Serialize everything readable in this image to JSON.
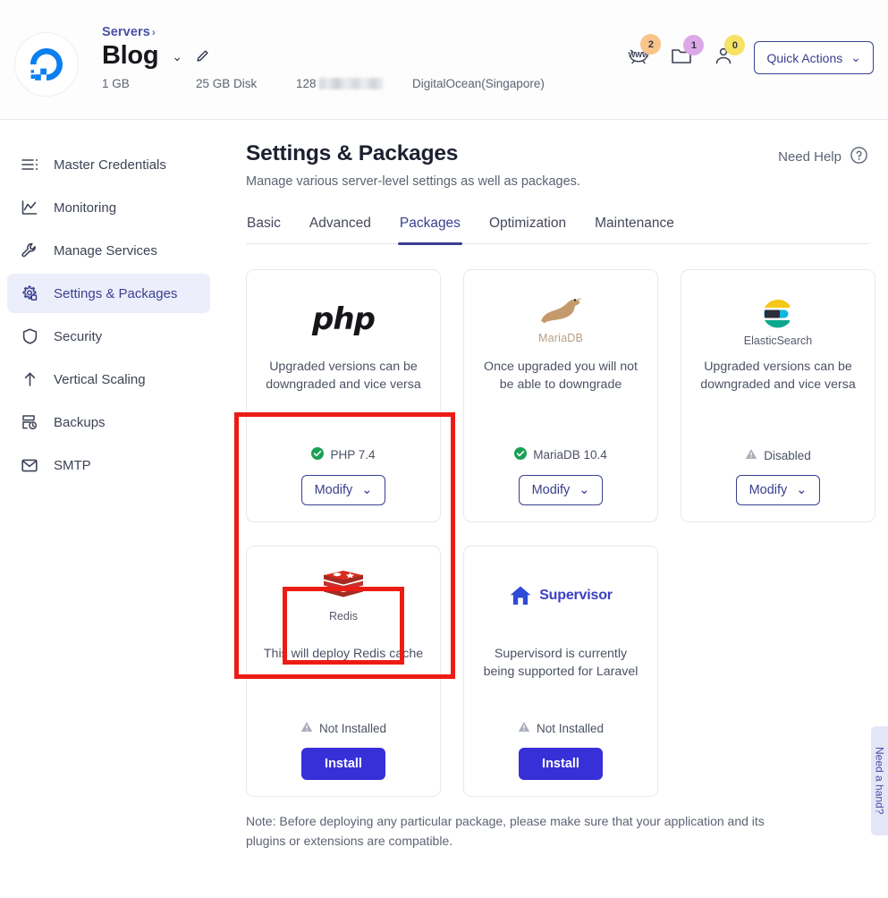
{
  "header": {
    "logo_icon": "digitalocean-logo",
    "breadcrumb": "Servers",
    "breadcrumb_chevron": "›",
    "server_name": "Blog",
    "caret": "⌄",
    "edit_icon": "pencil-icon",
    "specs": {
      "ram": "1 GB",
      "disk": "25 GB Disk",
      "ip_prefix": "128",
      "provider": "DigitalOcean(Singapore)"
    },
    "icons": [
      {
        "name": "www-icon",
        "badge": "2",
        "badge_color": "#f8c48a"
      },
      {
        "name": "folder-icon",
        "badge": "1",
        "badge_color": "#dba9e8"
      },
      {
        "name": "user-icon",
        "badge": "0",
        "badge_color": "#f6e263"
      }
    ],
    "quick_actions_label": "Quick Actions",
    "quick_actions_caret": "⌄"
  },
  "sidebar": {
    "items": [
      {
        "label": "Master Credentials",
        "icon": "list-icon",
        "active": false
      },
      {
        "label": "Monitoring",
        "icon": "chart-line-icon",
        "active": false
      },
      {
        "label": "Manage Services",
        "icon": "wrench-icon",
        "active": false
      },
      {
        "label": "Settings & Packages",
        "icon": "gear-icon",
        "active": true
      },
      {
        "label": "Security",
        "icon": "shield-icon",
        "active": false
      },
      {
        "label": "Vertical Scaling",
        "icon": "arrow-up-icon",
        "active": false
      },
      {
        "label": "Backups",
        "icon": "backup-icon",
        "active": false
      },
      {
        "label": "SMTP",
        "icon": "mail-icon",
        "active": false
      }
    ]
  },
  "main": {
    "title": "Settings & Packages",
    "subtitle": "Manage various server-level settings as well as packages.",
    "need_help_label": "Need Help",
    "need_help_icon": "question-circle-icon",
    "tabs": [
      {
        "label": "Basic",
        "active": false
      },
      {
        "label": "Advanced",
        "active": false
      },
      {
        "label": "Packages",
        "active": true
      },
      {
        "label": "Optimization",
        "active": false
      },
      {
        "label": "Maintenance",
        "active": false
      }
    ],
    "cards": [
      {
        "id": "php",
        "logo": "php-logo",
        "logo_text": "php",
        "caption": "",
        "description": "Upgraded versions can be downgraded and vice versa",
        "status_icon": "check-circle-icon",
        "status_text": "PHP 7.4",
        "status_color": "#1aa055",
        "action_label": "Modify",
        "action_caret": "⌄",
        "action_type": "modify"
      },
      {
        "id": "mariadb",
        "logo": "mariadb-logo",
        "logo_text": "",
        "caption": "MariaDB",
        "description": "Once upgraded you will not be able to downgrade",
        "status_icon": "check-circle-icon",
        "status_text": "MariaDB 10.4",
        "status_color": "#1aa055",
        "action_label": "Modify",
        "action_caret": "⌄",
        "action_type": "modify"
      },
      {
        "id": "elasticsearch",
        "logo": "elasticsearch-logo",
        "logo_text": "",
        "caption": "ElasticSearch",
        "description": "Upgraded versions can be downgraded and vice versa",
        "status_icon": "warning-triangle-icon",
        "status_text": "Disabled",
        "status_color": "#9aa0ad",
        "action_label": "Modify",
        "action_caret": "⌄",
        "action_type": "modify"
      },
      {
        "id": "redis",
        "logo": "redis-logo",
        "logo_text": "",
        "caption": "Redis",
        "description": "This will deploy Redis cache",
        "status_icon": "warning-triangle-icon",
        "status_text": "Not Installed",
        "status_color": "#9aa0ad",
        "action_label": "Install",
        "action_caret": "",
        "action_type": "install"
      },
      {
        "id": "supervisor",
        "logo": "supervisor-logo",
        "logo_text": "Supervisor",
        "caption": "",
        "description": "Supervisord is currently being supported for Laravel",
        "status_icon": "warning-triangle-icon",
        "status_text": "Not Installed",
        "status_color": "#9aa0ad",
        "action_label": "Install",
        "action_caret": "",
        "action_type": "install"
      }
    ],
    "note": "Note: Before deploying any particular package, please make sure that your application and its plugins or extensions are compatible."
  },
  "side_tab": {
    "label": "Need a hand?"
  },
  "annotations": {
    "color": "#ec1c15",
    "boxes": [
      {
        "name": "php-card-highlight"
      },
      {
        "name": "php-modify-highlight"
      }
    ]
  }
}
